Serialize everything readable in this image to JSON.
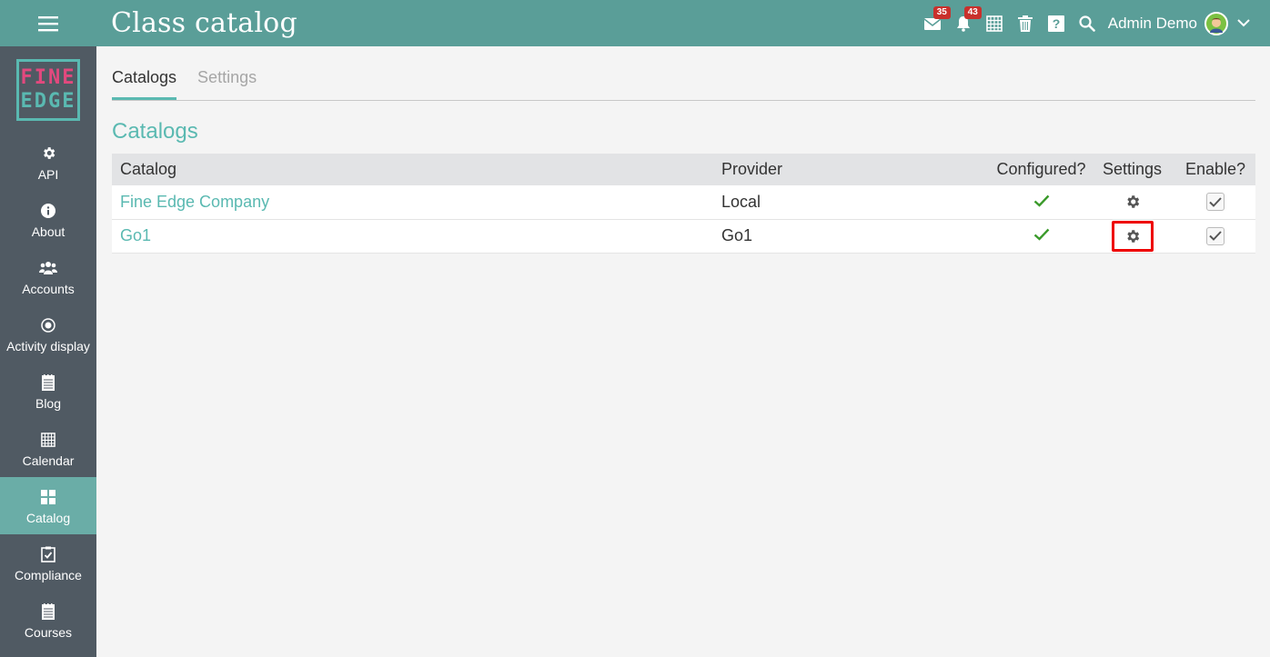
{
  "header": {
    "title": "Class catalog",
    "menu_icon": "hamburger-icon",
    "messages_badge": "35",
    "notifications_badge": "43",
    "user_name": "Admin Demo",
    "accent_color": "#5a9e98"
  },
  "sidebar": {
    "logo_line1": "FINE",
    "logo_line2": "EDGE",
    "items": [
      {
        "label": "API",
        "icon": "gear-icon"
      },
      {
        "label": "About",
        "icon": "info-icon"
      },
      {
        "label": "Accounts",
        "icon": "users-icon"
      },
      {
        "label": "Activity display",
        "icon": "radio-dot-icon"
      },
      {
        "label": "Blog",
        "icon": "notebook-icon"
      },
      {
        "label": "Calendar",
        "icon": "calendar-grid-icon"
      },
      {
        "label": "Catalog",
        "icon": "grid-icon",
        "active": true
      },
      {
        "label": "Compliance",
        "icon": "clipboard-check-icon"
      },
      {
        "label": "Courses",
        "icon": "notebook-icon"
      }
    ]
  },
  "tabs": [
    {
      "label": "Catalogs",
      "active": true
    },
    {
      "label": "Settings",
      "active": false
    }
  ],
  "section_title": "Catalogs",
  "table": {
    "headers": [
      "Catalog",
      "Provider",
      "Configured?",
      "Settings",
      "Enable?"
    ],
    "rows": [
      {
        "catalog": "Fine Edge Company",
        "provider": "Local",
        "configured": true,
        "enabled": true
      },
      {
        "catalog": "Go1",
        "provider": "Go1",
        "configured": true,
        "enabled": true,
        "settings_highlighted": true
      }
    ]
  },
  "colors": {
    "sidebar_bg": "#505a63",
    "sidebar_active": "#6aada7",
    "link": "#5ab9b1",
    "check": "#3a9a2a",
    "highlight": "#e00000"
  }
}
